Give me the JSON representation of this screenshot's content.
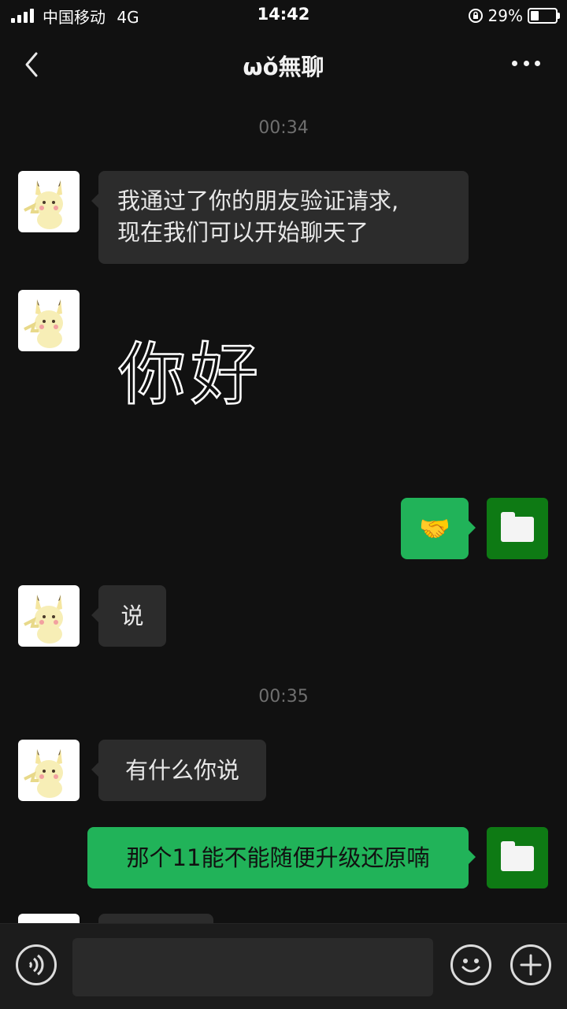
{
  "status_bar": {
    "carrier": "中国移动",
    "network": "4G",
    "time": "14:42",
    "battery": "29%",
    "battery_level": 0.29
  },
  "header": {
    "title": "ωǒ無聊",
    "back_icon": "chevron-left-icon",
    "more_icon": "more-dots-icon"
  },
  "timestamps": [
    "00:34",
    "00:35"
  ],
  "messages": [
    {
      "side": "received",
      "type": "text",
      "text": "我通过了你的朋友验证请求,\n现在我们可以开始聊天了"
    },
    {
      "side": "received",
      "type": "sticker",
      "text": "你好"
    },
    {
      "side": "sent",
      "type": "emoji",
      "text": "🤝"
    },
    {
      "side": "received",
      "type": "text",
      "text": "说"
    },
    {
      "side": "received",
      "type": "text",
      "text": "有什么你说"
    },
    {
      "side": "sent",
      "type": "text",
      "text": "那个11能不能随便升级还原喃"
    }
  ],
  "input_bar": {
    "voice_icon": "voice-icon",
    "emoji_icon": "emoji-icon",
    "add_icon": "plus-icon",
    "placeholder": ""
  },
  "colors": {
    "background": "#111111",
    "received_bubble": "#2c2c2c",
    "sent_bubble": "#21b359",
    "self_avatar": "#0e7a14"
  }
}
